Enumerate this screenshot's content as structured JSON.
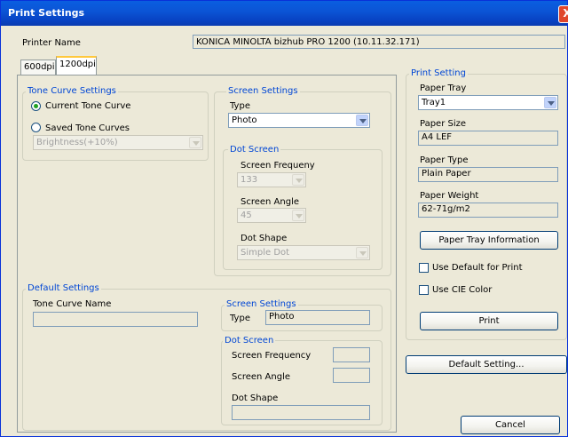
{
  "window": {
    "title": "Print Settings",
    "close": "X"
  },
  "printer": {
    "label": "Printer Name",
    "value": "KONICA MINOLTA bizhub PRO 1200 (10.11.32.171)"
  },
  "tabs": [
    {
      "label": "600dpi"
    },
    {
      "label": "1200dpi"
    }
  ],
  "tone_curve": {
    "title": "Tone Curve Settings",
    "current_label": "Current Tone Curve",
    "saved_label": "Saved Tone Curves",
    "saved_value": "Brightness(+10%)"
  },
  "screen_settings": {
    "title": "Screen Settings",
    "type_label": "Type",
    "type_value": "Photo",
    "dot_screen": {
      "title": "Dot Screen",
      "freq_label": "Screen Frequeny",
      "freq_value": "133",
      "angle_label": "Screen Angle",
      "angle_value": "45",
      "shape_label": "Dot Shape",
      "shape_value": "Simple Dot"
    }
  },
  "default_settings": {
    "title": "Default Settings",
    "tone_curve_label": "Tone Curve Name",
    "tone_curve_value": "",
    "screen_title": "Screen Settings",
    "type_label": "Type",
    "type_value": "Photo",
    "dot_title": "Dot Screen",
    "freq_label": "Screen Frequency",
    "angle_label": "Screen Angle",
    "shape_label": "Dot Shape"
  },
  "print_setting": {
    "title": "Print Setting",
    "tray_label": "Paper Tray",
    "tray_value": "Tray1",
    "size_label": "Paper Size",
    "size_value": "A4 LEF",
    "type_label": "Paper Type",
    "type_value": "Plain Paper",
    "weight_label": "Paper Weight",
    "weight_value": "62-71g/m2",
    "tray_info_button": "Paper Tray Information",
    "default_for_print": "Use Default for Print",
    "cie_color": "Use CIE Color",
    "print_button": "Print"
  },
  "buttons": {
    "default_setting": "Default Setting...",
    "cancel": "Cancel"
  }
}
